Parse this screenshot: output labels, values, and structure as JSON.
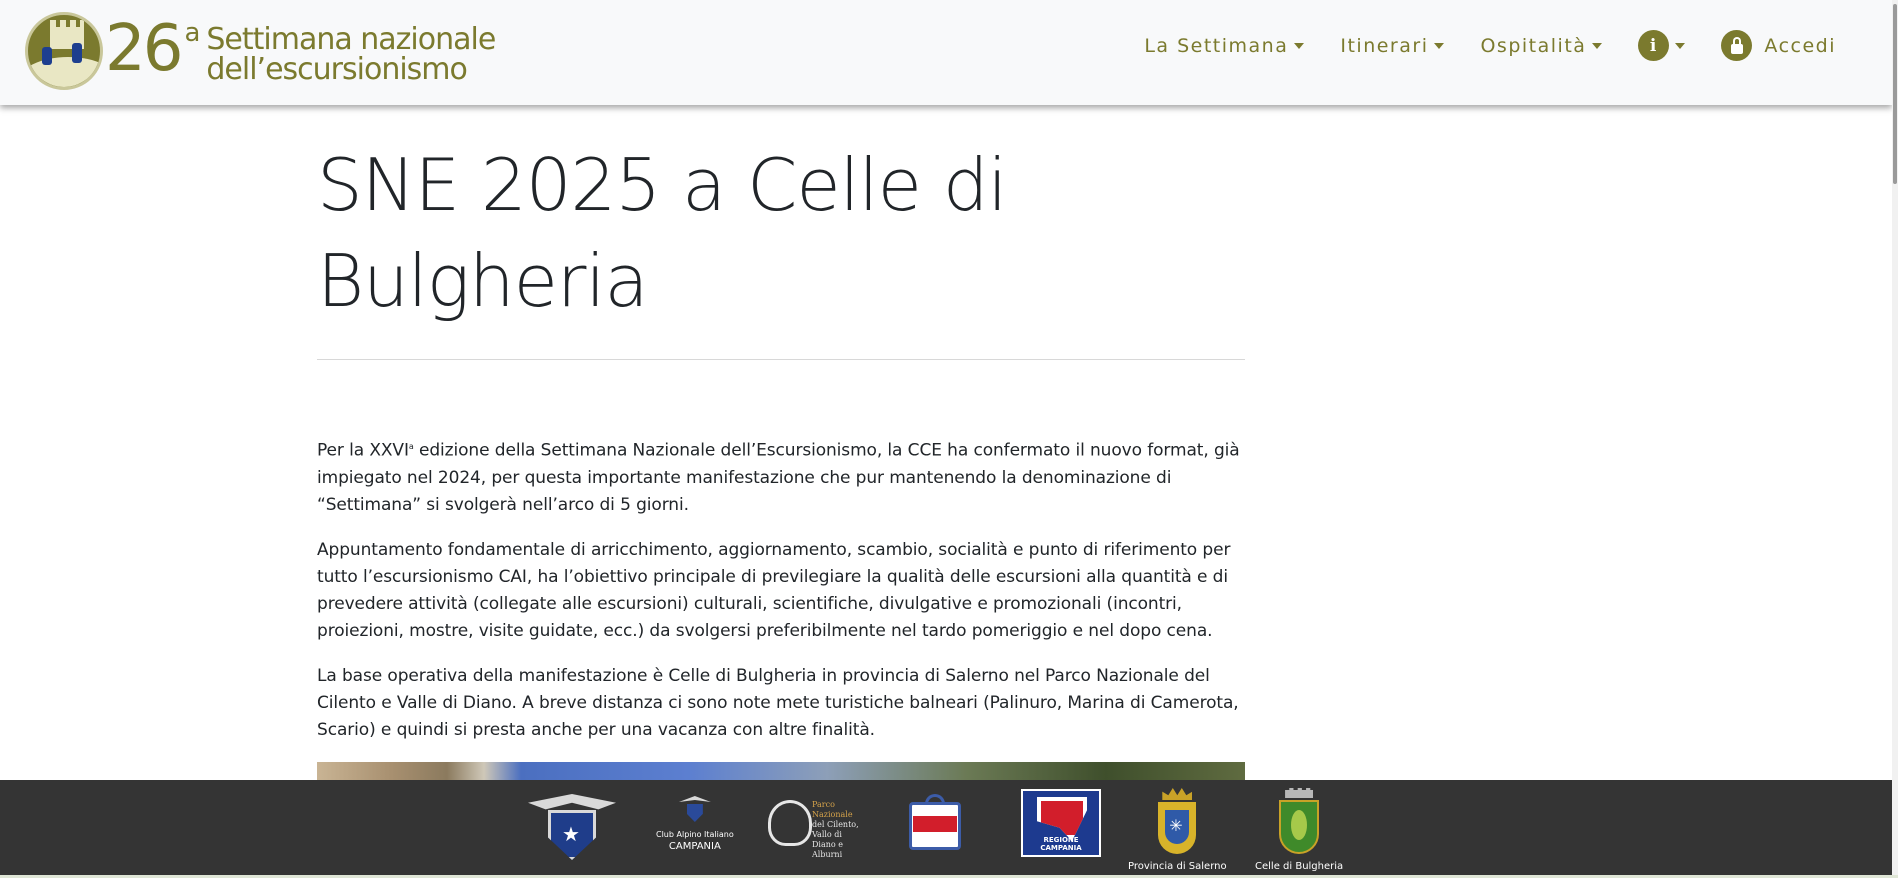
{
  "header": {
    "brand": {
      "number": "26",
      "superscript": "a",
      "line1": "Settimana nazionale",
      "line2": "dell’escursionismo"
    },
    "nav": [
      {
        "label": "La Settimana",
        "has_dropdown": true
      },
      {
        "label": "Itinerari",
        "has_dropdown": true
      },
      {
        "label": "Ospitalità",
        "has_dropdown": true
      }
    ],
    "info_icon": "i",
    "login_label": "Accedi"
  },
  "main": {
    "title": "SNE 2025 a Celle di Bulgheria",
    "paragraphs": [
      "Per la XXVI",
      "Appuntamento fondamentale di arricchimento, aggiornamento, scambio, socialità e punto di riferimento per tutto l’escursionismo CAI, ha l’obiettivo principale di previlegiare la qualità delle escursioni alla quantità e di prevedere attività (collegate alle escursioni) culturali, scientifiche, divulgative e promozionali (incontri, proiezioni, mostre, visite guidate, ecc.) da svolgersi preferibilmente nel tardo pomeriggio e nel dopo cena.",
      "La base operativa della manifestazione è Celle di Bulgheria in provincia di Salerno nel Parco Nazionale del Cilento e Valle di Diano. A breve distanza ci sono note mete turistiche balneari (Palinuro, Marina di Camerota, Scario) e quindi si presta anche per una vacanza con altre finalità."
    ],
    "p1_sup": "a",
    "p1_rest": " edizione della Settimana Nazionale dell’Escursionismo, la CCE ha confermato il nuovo format, già impiegato nel 2024, per questa importante manifestazione che pur mantenendo la denominazione di “Settimana” si svolgerà nell’arco di 5 giorni."
  },
  "footer": {
    "sponsors": [
      {
        "icon": "cai-eagle-icon"
      },
      {
        "icon": "cai-campania-icon",
        "caption_line1": "Club Alpino Italiano",
        "caption_line2": "CAMPANIA"
      },
      {
        "icon": "parco-cilento-icon",
        "text_a": "Parco Nazionale",
        "text_b": "del Cilento, Vallo di Diano e Alburni"
      },
      {
        "icon": "sponsor-crest-icon"
      },
      {
        "icon": "regione-campania-icon",
        "caption": "REGIONE CAMPANIA"
      },
      {
        "icon": "provincia-salerno-icon",
        "caption": "Provincia di Salerno"
      },
      {
        "icon": "celle-di-bulgheria-icon",
        "caption": "Celle di Bulgheria"
      }
    ]
  },
  "colors": {
    "brand": "#7b7a2e",
    "footer_bg": "#343434",
    "header_bg": "#f8f9fa"
  }
}
